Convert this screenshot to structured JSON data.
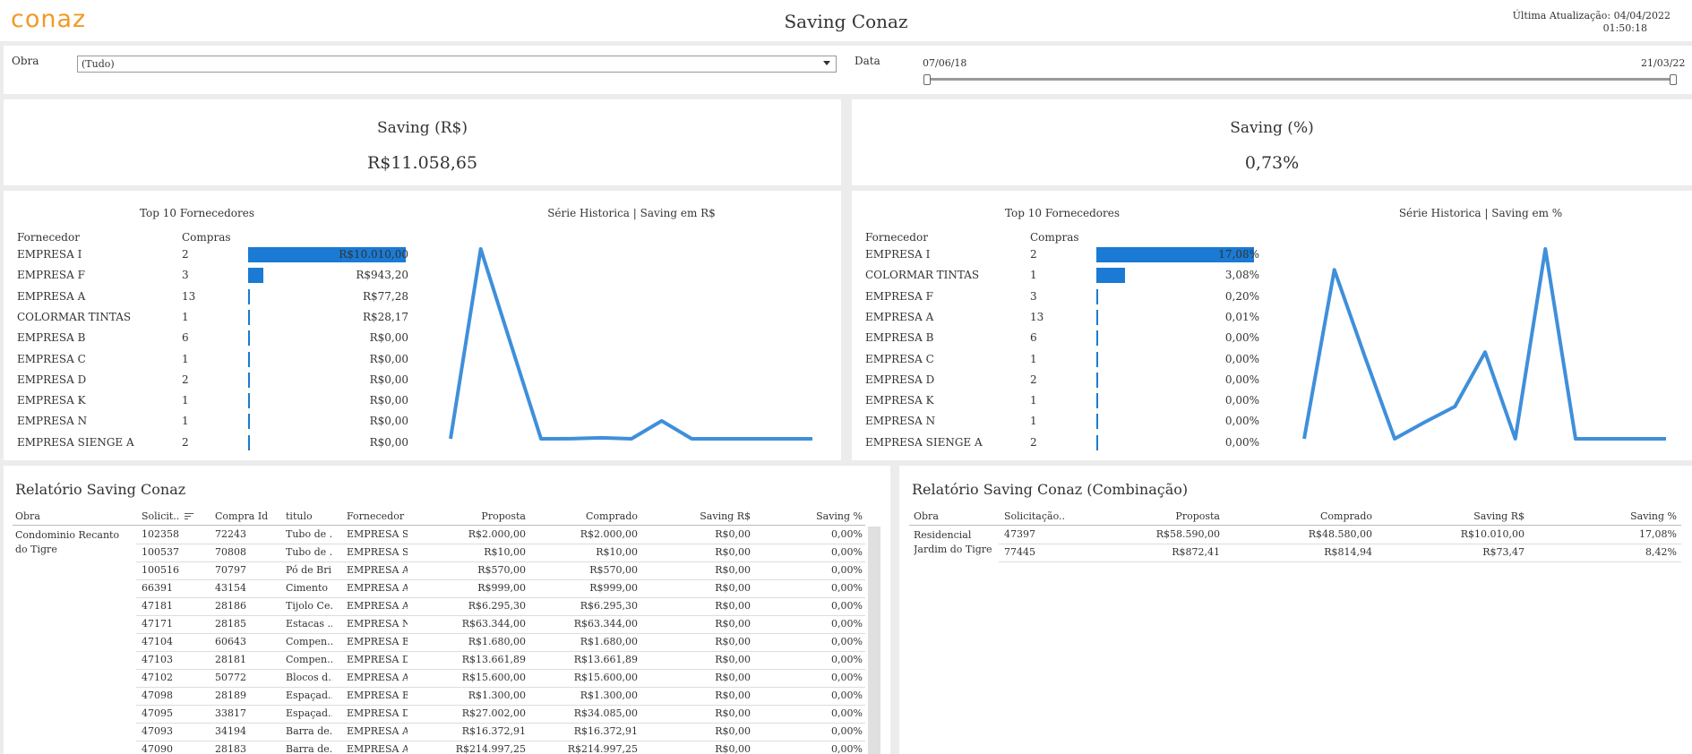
{
  "header": {
    "logo": "conaz",
    "title": "Saving Conaz",
    "update_label": "Última Atualização: 04/04/2022",
    "update_time": "01:50:18"
  },
  "filters": {
    "obra_label": "Obra",
    "obra_value": "(Tudo)",
    "data_label": "Data",
    "date_start": "07/06/18",
    "date_end": "21/03/22"
  },
  "kpi": {
    "saving_rs_title": "Saving (R$)",
    "saving_rs_value": "R$11.058,65",
    "saving_pct_title": "Saving (%)",
    "saving_pct_value": "0,73%"
  },
  "left_panel": {
    "top_title": "Top 10 Fornecedores",
    "series_title": "Série Historica | Saving em R$",
    "col_fornecedor": "Fornecedor",
    "col_compras": "Compras",
    "rows": [
      {
        "name": "EMPRESA I",
        "count": "2",
        "value": "R$10.010,00",
        "frac": 1.0
      },
      {
        "name": "EMPRESA F",
        "count": "3",
        "value": "R$943,20",
        "frac": 0.094
      },
      {
        "name": "EMPRESA A",
        "count": "13",
        "value": "R$77,28",
        "frac": 0.008
      },
      {
        "name": "COLORMAR TINTAS",
        "count": "1",
        "value": "R$28,17",
        "frac": 0.003
      },
      {
        "name": "EMPRESA B",
        "count": "6",
        "value": "R$0,00",
        "frac": 0
      },
      {
        "name": "EMPRESA C",
        "count": "1",
        "value": "R$0,00",
        "frac": 0
      },
      {
        "name": "EMPRESA D",
        "count": "2",
        "value": "R$0,00",
        "frac": 0
      },
      {
        "name": "EMPRESA K",
        "count": "1",
        "value": "R$0,00",
        "frac": 0
      },
      {
        "name": "EMPRESA N",
        "count": "1",
        "value": "R$0,00",
        "frac": 0
      },
      {
        "name": "EMPRESA SIENGE A",
        "count": "2",
        "value": "R$0,00",
        "frac": 0
      }
    ]
  },
  "right_panel": {
    "top_title": "Top 10 Fornecedores",
    "series_title": "Série Historica | Saving em %",
    "col_fornecedor": "Fornecedor",
    "col_compras": "Compras",
    "rows": [
      {
        "name": "EMPRESA I",
        "count": "2",
        "value": "17,08%",
        "frac": 1.0
      },
      {
        "name": "COLORMAR TINTAS",
        "count": "1",
        "value": "3,08%",
        "frac": 0.18
      },
      {
        "name": "EMPRESA F",
        "count": "3",
        "value": "0,20%",
        "frac": 0.012
      },
      {
        "name": "EMPRESA A",
        "count": "13",
        "value": "0,01%",
        "frac": 0.001
      },
      {
        "name": "EMPRESA B",
        "count": "6",
        "value": "0,00%",
        "frac": 0
      },
      {
        "name": "EMPRESA C",
        "count": "1",
        "value": "0,00%",
        "frac": 0
      },
      {
        "name": "EMPRESA D",
        "count": "2",
        "value": "0,00%",
        "frac": 0
      },
      {
        "name": "EMPRESA K",
        "count": "1",
        "value": "0,00%",
        "frac": 0
      },
      {
        "name": "EMPRESA N",
        "count": "1",
        "value": "0,00%",
        "frac": 0
      },
      {
        "name": "EMPRESA SIENGE A",
        "count": "2",
        "value": "0,00%",
        "frac": 0
      }
    ]
  },
  "chart_data": [
    {
      "type": "bar",
      "categories": [
        "EMPRESA I",
        "EMPRESA F",
        "EMPRESA A",
        "COLORMAR TINTAS",
        "EMPRESA B",
        "EMPRESA C",
        "EMPRESA D",
        "EMPRESA K",
        "EMPRESA N",
        "EMPRESA SIENGE A"
      ],
      "values": [
        10010.0,
        943.2,
        77.28,
        28.17,
        0,
        0,
        0,
        0,
        0,
        0
      ],
      "title": "Top 10 Fornecedores"
    },
    {
      "type": "line",
      "title": "Série Historica | Saving em R$",
      "values": [
        0,
        10010,
        5000,
        0,
        5,
        50,
        0,
        943,
        0,
        0,
        0,
        0,
        0
      ],
      "ylim": [
        0,
        10010
      ]
    },
    {
      "type": "bar",
      "categories": [
        "EMPRESA I",
        "COLORMAR TINTAS",
        "EMPRESA F",
        "EMPRESA A",
        "EMPRESA B",
        "EMPRESA C",
        "EMPRESA D",
        "EMPRESA K",
        "EMPRESA N",
        "EMPRESA SIENGE A"
      ],
      "values": [
        17.08,
        3.08,
        0.2,
        0.01,
        0,
        0,
        0,
        0,
        0,
        0
      ],
      "title": "Top 10 Fornecedores"
    },
    {
      "type": "line",
      "title": "Série Historica | Saving em %",
      "values": [
        0,
        15.2,
        7.5,
        0,
        1.5,
        2.9,
        7.8,
        0,
        17.08,
        0,
        0,
        0,
        0
      ],
      "ylim": [
        0,
        17.08
      ]
    }
  ],
  "report": {
    "title": "Relatório Saving Conaz",
    "headers": [
      "Obra",
      "Solicit..",
      "Compra Id",
      "titulo",
      "Fornecedor",
      "Proposta",
      "Comprado",
      "Saving R$",
      "Saving %"
    ],
    "obra": "Condominio Recanto do Tigre",
    "rows": [
      [
        "102358",
        "72243",
        "Tubo de ..",
        "EMPRESA S..",
        "R$2.000,00",
        "R$2.000,00",
        "R$0,00",
        "0,00%"
      ],
      [
        "100537",
        "70808",
        "Tubo de ..",
        "EMPRESA S..",
        "R$10,00",
        "R$10,00",
        "R$0,00",
        "0,00%"
      ],
      [
        "100516",
        "70797",
        "Pó de Bri..",
        "EMPRESA A",
        "R$570,00",
        "R$570,00",
        "R$0,00",
        "0,00%"
      ],
      [
        "66391",
        "43154",
        "Cimento",
        "EMPRESA A",
        "R$999,00",
        "R$999,00",
        "R$0,00",
        "0,00%"
      ],
      [
        "47181",
        "28186",
        "Tijolo Ce..",
        "EMPRESA A",
        "R$6.295,30",
        "R$6.295,30",
        "R$0,00",
        "0,00%"
      ],
      [
        "47171",
        "28185",
        "Estacas ..",
        "EMPRESA N",
        "R$63.344,00",
        "R$63.344,00",
        "R$0,00",
        "0,00%"
      ],
      [
        "47104",
        "60643",
        "Compen..",
        "EMPRESA B",
        "R$1.680,00",
        "R$1.680,00",
        "R$0,00",
        "0,00%"
      ],
      [
        "47103",
        "28181",
        "Compen..",
        "EMPRESA D",
        "R$13.661,89",
        "R$13.661,89",
        "R$0,00",
        "0,00%"
      ],
      [
        "47102",
        "50772",
        "Blocos d..",
        "EMPRESA A",
        "R$15.600,00",
        "R$15.600,00",
        "R$0,00",
        "0,00%"
      ],
      [
        "47098",
        "28189",
        "Espaçad..",
        "EMPRESA B",
        "R$1.300,00",
        "R$1.300,00",
        "R$0,00",
        "0,00%"
      ],
      [
        "47095",
        "33817",
        "Espaçad..",
        "EMPRESA D",
        "R$27.002,00",
        "R$34.085,00",
        "R$0,00",
        "0,00%"
      ],
      [
        "47093",
        "34194",
        "Barra de..",
        "EMPRESA A",
        "R$16.372,91",
        "R$16.372,91",
        "R$0,00",
        "0,00%"
      ],
      [
        "47090",
        "28183",
        "Barra de..",
        "EMPRESA A",
        "R$214.997,25",
        "R$214.997,25",
        "R$0,00",
        "0,00%"
      ]
    ]
  },
  "report2": {
    "title": "Relatório Saving Conaz (Combinação)",
    "headers": [
      "Obra",
      "Solicitação..",
      "Proposta",
      "Comprado",
      "Saving R$",
      "Saving %"
    ],
    "obra": "Residencial Jardim do Tigre",
    "rows": [
      [
        "47397",
        "R$58.590,00",
        "R$48.580,00",
        "R$10.010,00",
        "17,08%"
      ],
      [
        "77445",
        "R$872,41",
        "R$814,94",
        "R$73,47",
        "8,42%"
      ]
    ]
  }
}
